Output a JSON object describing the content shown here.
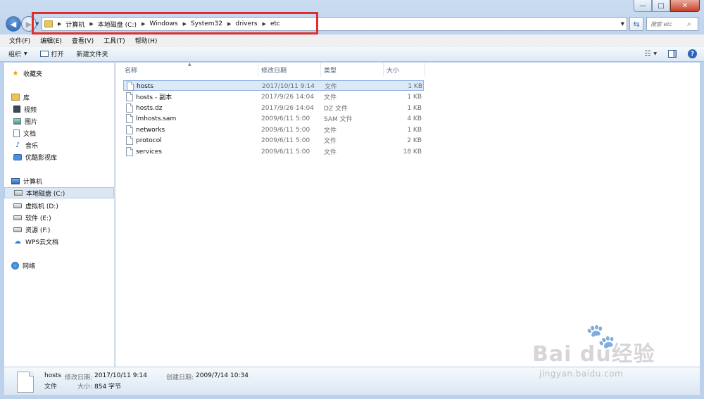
{
  "window": {
    "caption_minimize": "—",
    "caption_maximize": "□",
    "caption_close": "✕"
  },
  "address_bar": {
    "breadcrumbs": [
      "计算机",
      "本地磁盘 (C:)",
      "Windows",
      "System32",
      "drivers",
      "etc"
    ],
    "search_placeholder": "搜索 etc"
  },
  "menu": [
    "文件(F)",
    "编辑(E)",
    "查看(V)",
    "工具(T)",
    "帮助(H)"
  ],
  "toolbar": {
    "organize": "组织",
    "open": "打开",
    "new_folder": "新建文件夹"
  },
  "nav_pane": {
    "favorites": "收藏夹",
    "libraries": "库",
    "lib_items": [
      "视频",
      "图片",
      "文档",
      "音乐",
      "优酷影视库"
    ],
    "computer": "计算机",
    "drives": [
      "本地磁盘 (C:)",
      "虚拟机 (D:)",
      "软件 (E:)",
      "资源 (F:)",
      "WPS云文档"
    ],
    "network": "网络"
  },
  "columns": {
    "name": "名称",
    "modified": "修改日期",
    "type": "类型",
    "size": "大小"
  },
  "files": [
    {
      "name": "hosts",
      "modified": "2017/10/11 9:14",
      "type": "文件",
      "size": "1 KB"
    },
    {
      "name": "hosts - 副本",
      "modified": "2017/9/26 14:04",
      "type": "文件",
      "size": "1 KB"
    },
    {
      "name": "hosts.dz",
      "modified": "2017/9/26 14:04",
      "type": "DZ 文件",
      "size": "1 KB"
    },
    {
      "name": "lmhosts.sam",
      "modified": "2009/6/11 5:00",
      "type": "SAM 文件",
      "size": "4 KB"
    },
    {
      "name": "networks",
      "modified": "2009/6/11 5:00",
      "type": "文件",
      "size": "1 KB"
    },
    {
      "name": "protocol",
      "modified": "2009/6/11 5:00",
      "type": "文件",
      "size": "2 KB"
    },
    {
      "name": "services",
      "modified": "2009/6/11 5:00",
      "type": "文件",
      "size": "18 KB"
    }
  ],
  "details": {
    "name": "hosts",
    "type": "文件",
    "modified_label": "修改日期:",
    "modified_value": "2017/10/11 9:14",
    "created_label": "创建日期:",
    "created_value": "2009/7/14 10:34",
    "size_label": "大小:",
    "size_value": "854 字节"
  },
  "watermark": {
    "brand": "Bai  du",
    "brand_cn": "经验",
    "url": "jingyan.baidu.com"
  },
  "colors": {
    "highlight_box": "#e02c2c",
    "selection": "#dce9f8",
    "frame": "#c9dcf1"
  }
}
